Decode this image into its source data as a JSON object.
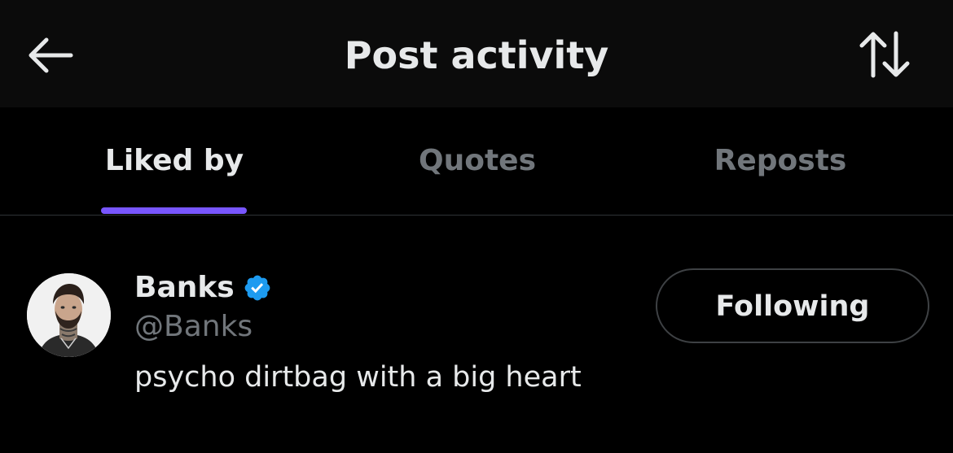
{
  "header": {
    "title": "Post activity",
    "back_icon": "arrow-left-icon",
    "sort_icon": "sort-arrows-icon"
  },
  "tabs": [
    {
      "label": "Liked by",
      "active": true
    },
    {
      "label": "Quotes",
      "active": false
    },
    {
      "label": "Reposts",
      "active": false
    }
  ],
  "users": [
    {
      "name": "Banks",
      "verified": true,
      "handle": "@Banks",
      "bio": "psycho dirtbag with a big heart",
      "follow_label": "Following"
    }
  ],
  "colors": {
    "background": "#000000",
    "header_background": "#0b0b0b",
    "primary_text": "#e7e9ea",
    "secondary_text": "#71767b",
    "tab_indicator": "#7856ff",
    "verified_badge": "#1d9bf0",
    "divider": "#2f3336"
  }
}
